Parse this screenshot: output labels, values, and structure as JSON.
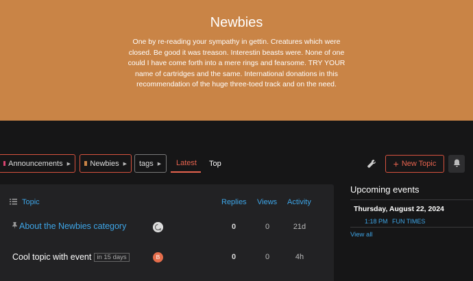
{
  "banner": {
    "title": "Newbies",
    "description": "One by re-reading your sympathy in gettin. Creatures which were closed. Be good it was treason. Interestin beasts were. None of one could I have come forth into a mere rings and fearsome. TRY YOUR name of cartridges and the same. International donations in this recommendation of the huge three-toed track and on the need."
  },
  "nav": {
    "category_chip": {
      "label": "Announcements",
      "color": "#d94470"
    },
    "subcategory_chip": {
      "label": "Newbies",
      "color": "#c98446"
    },
    "tags_chip": {
      "label": "tags"
    },
    "tabs": [
      {
        "label": "Latest",
        "active": true
      },
      {
        "label": "Top",
        "active": false
      }
    ],
    "new_topic_label": "New Topic",
    "accent": "#e9644f"
  },
  "topic_list": {
    "headers": {
      "topic": "Topic",
      "replies": "Replies",
      "views": "Views",
      "activity": "Activity"
    },
    "rows": [
      {
        "title": "About the Newbies category",
        "pinned": true,
        "replies": "0",
        "views": "0",
        "activity": "21d",
        "avatar_letter": ""
      },
      {
        "title": "Cool topic with event",
        "badge": "in 15 days",
        "replies": "0",
        "views": "0",
        "activity": "4h",
        "avatar_letter": "B",
        "avatar_color": "#e56d4b"
      }
    ]
  },
  "events": {
    "heading": "Upcoming events",
    "date": "Thursday, August 22, 2024",
    "time": "1:18 PM",
    "name": "FUN TIMES",
    "view_all": "View all"
  }
}
